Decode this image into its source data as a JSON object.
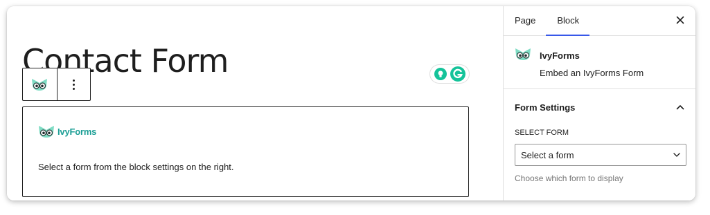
{
  "canvas": {
    "page_title": "Contact Form",
    "block_toolbar": {
      "block_icon": "ivyforms-owl-icon",
      "options_icon": "more-vertical-icon"
    },
    "extension_badges": {
      "icons": [
        "lightbulb-icon",
        "grammarly-icon"
      ]
    },
    "form_block": {
      "brand_name": "IvyForms",
      "placeholder_text": "Select a form from the block settings on the right."
    }
  },
  "sidebar": {
    "tabs": [
      {
        "label": "Page",
        "active": false
      },
      {
        "label": "Block",
        "active": true
      }
    ],
    "close_icon": "close-icon",
    "block_card": {
      "title": "IvyForms",
      "description": "Embed an IvyForms Form"
    },
    "form_settings": {
      "title": "Form Settings",
      "select_label": "SELECT FORM",
      "select_value": "Select a form",
      "help_text": "Choose which form to display"
    }
  },
  "colors": {
    "accent": "#3858e9",
    "brand_teal": "#1a9e95",
    "owl_mint": "#7fdcc4",
    "grammarly_green": "#15c39a",
    "help_text": "#757575"
  }
}
